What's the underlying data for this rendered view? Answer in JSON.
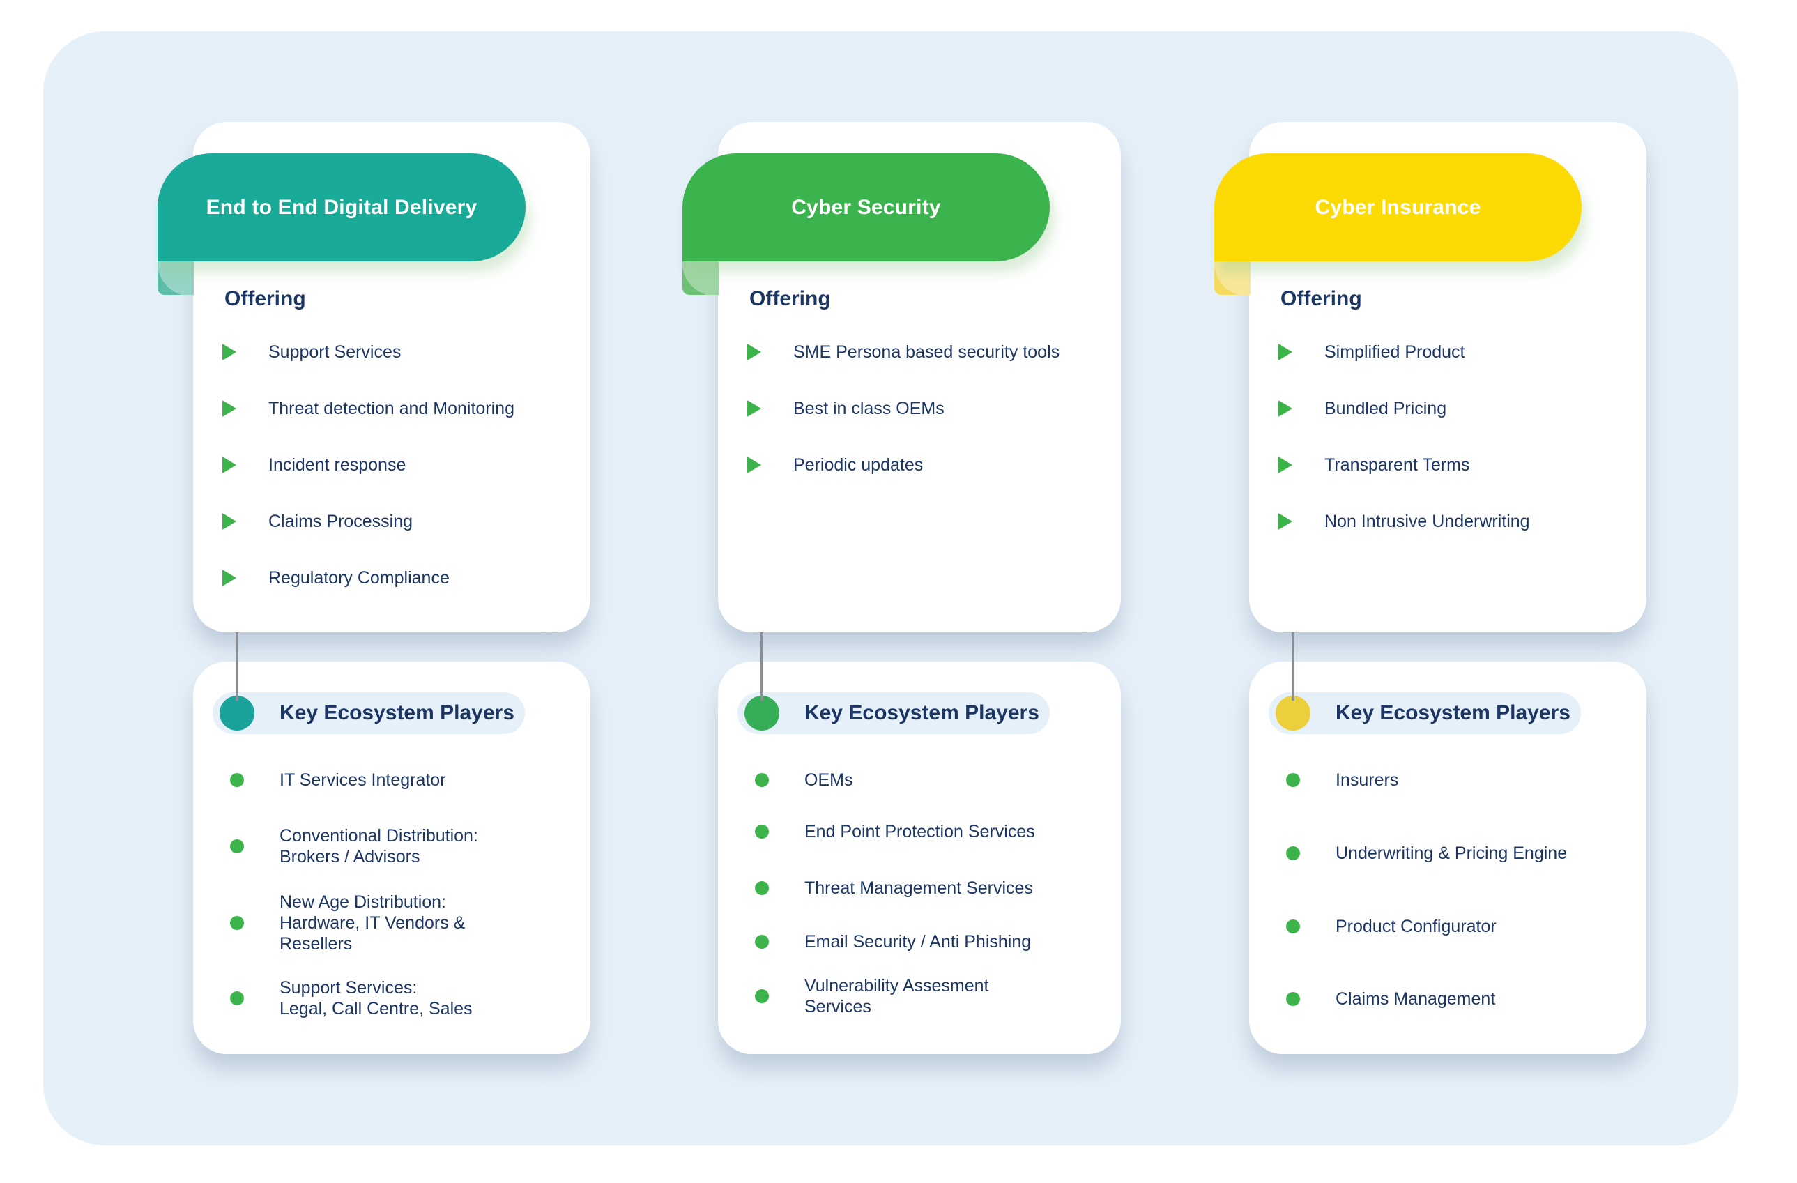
{
  "colors": {
    "panel_bg": "#E6F0F9",
    "card_bg": "#FFFFFF",
    "text_navy": "#1C3664",
    "bullet_green": "#3CB44B",
    "connector_gray": "#8A8F96"
  },
  "columns": [
    {
      "title": "End to End Digital Delivery",
      "accent": "#1AAA98",
      "fold_color": "#5DBDA8",
      "dot_color": "#1AA39A",
      "offering_label": "Offering",
      "offerings": [
        "Support Services",
        "Threat detection and Monitoring",
        "Incident response",
        "Claims Processing",
        "Regulatory Compliance"
      ],
      "players_label": "Key Ecosystem Players",
      "players": [
        "IT Services Integrator",
        "Conventional Distribution:\nBrokers / Advisors",
        "New Age Distribution:\nHardware, IT Vendors &\nResellers",
        "Support Services:\nLegal, Call Centre, Sales"
      ]
    },
    {
      "title": "Cyber Security",
      "accent": "#3CB44E",
      "fold_color": "#6CC175",
      "dot_color": "#36AE58",
      "offering_label": "Offering",
      "offerings": [
        "SME Persona based security tools",
        "Best in class OEMs",
        "Periodic updates"
      ],
      "players_label": "Key Ecosystem Players",
      "players": [
        "OEMs",
        "End Point Protection Services",
        "Threat Management Services",
        "Email Security / Anti Phishing",
        "Vulnerability Assesment\nServices"
      ]
    },
    {
      "title": "Cyber Insurance",
      "accent": "#FBDA06",
      "fold_color": "#F5DB60",
      "dot_color": "#EBCF3C",
      "offering_label": "Offering",
      "offerings": [
        "Simplified Product",
        "Bundled Pricing",
        "Transparent Terms",
        "Non Intrusive Underwriting"
      ],
      "players_label": "Key Ecosystem Players",
      "players": [
        "Insurers",
        "Underwriting & Pricing Engine",
        "Product Configurator",
        "Claims Management"
      ]
    }
  ]
}
